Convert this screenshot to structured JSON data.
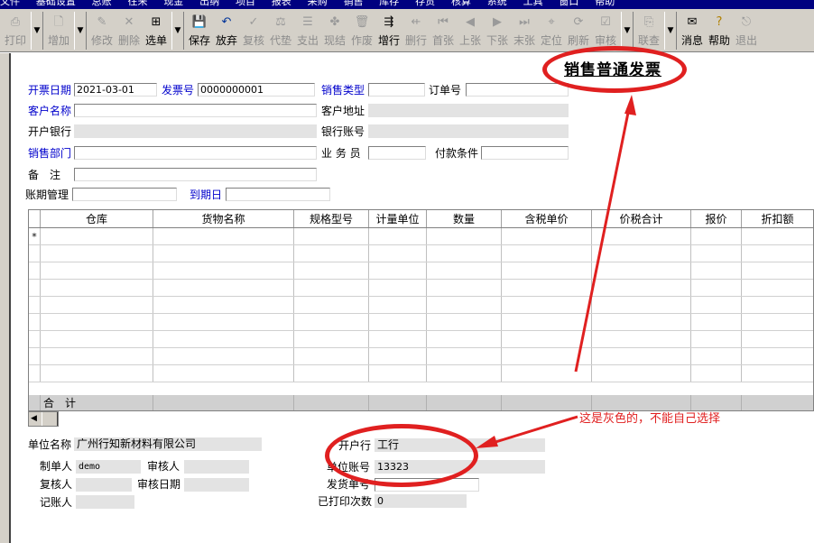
{
  "menubar": {
    "items": [
      "文件",
      "基础设置",
      "总账",
      "往来",
      "现金",
      "出纳",
      "项目",
      "报表",
      "采购",
      "销售",
      "库存",
      "存货",
      "核算",
      "系统",
      "工具",
      "窗口",
      "帮助"
    ]
  },
  "toolbar": {
    "buttons": [
      {
        "label": "打印",
        "icon": "printer-icon"
      },
      {
        "label": "增加",
        "icon": "new-document-icon"
      },
      {
        "label": "修改",
        "icon": "edit-icon"
      },
      {
        "label": "删除",
        "icon": "delete-icon"
      },
      {
        "label": "选单",
        "icon": "select-order-icon"
      },
      {
        "label": "保存",
        "icon": "save-icon"
      },
      {
        "label": "放弃",
        "icon": "undo-icon"
      },
      {
        "label": "复核",
        "icon": "review-icon"
      },
      {
        "label": "代垫",
        "icon": "advance-icon"
      },
      {
        "label": "支出",
        "icon": "expense-icon"
      },
      {
        "label": "现结",
        "icon": "cash-settle-icon"
      },
      {
        "label": "作废",
        "icon": "void-icon"
      },
      {
        "label": "增行",
        "icon": "add-row-icon"
      },
      {
        "label": "删行",
        "icon": "delete-row-icon"
      },
      {
        "label": "首张",
        "icon": "first-icon"
      },
      {
        "label": "上张",
        "icon": "prev-icon"
      },
      {
        "label": "下张",
        "icon": "next-icon"
      },
      {
        "label": "末张",
        "icon": "last-icon"
      },
      {
        "label": "定位",
        "icon": "locate-icon"
      },
      {
        "label": "刷新",
        "icon": "refresh-icon"
      },
      {
        "label": "审核",
        "icon": "audit-icon"
      },
      {
        "label": "联查",
        "icon": "link-query-icon"
      },
      {
        "label": "消息",
        "icon": "message-icon"
      },
      {
        "label": "帮助",
        "icon": "help-icon"
      },
      {
        "label": "退出",
        "icon": "exit-icon"
      }
    ]
  },
  "header": {
    "title": "销售普通发票",
    "invoice_date_label": "开票日期",
    "invoice_date": "2021-03-01",
    "invoice_no_label": "发票号",
    "invoice_no": "0000000001",
    "sales_type_label": "销售类型",
    "sales_type": "",
    "order_no_label": "订单号",
    "order_no": "",
    "customer_name_label": "客户名称",
    "customer_name": "",
    "customer_address_label": "客户地址",
    "customer_address": "",
    "bank_label": "开户银行",
    "bank": "",
    "bank_account_label": "银行账号",
    "bank_account": "",
    "sales_dept_label": "销售部门",
    "sales_dept": "",
    "salesperson_label": "业 务 员",
    "salesperson": "",
    "payment_terms_label": "付款条件",
    "payment_terms": "",
    "remark_label": "备　注",
    "remark": "",
    "account_mgmt_label": "账期管理",
    "account_mgmt": "",
    "due_date_label": "到期日",
    "due_date": ""
  },
  "grid": {
    "columns": [
      "仓库",
      "货物名称",
      "规格型号",
      "计量单位",
      "数量",
      "含税单价",
      "价税合计",
      "报价",
      "折扣额"
    ],
    "new_row_marker": "*",
    "sum_label": "合　计"
  },
  "footer": {
    "company_label": "单位名称",
    "company": "广州行知新材料有限公司",
    "bank_label": "开户行",
    "bank": "工行",
    "account_label": "单位账号",
    "account": "13323",
    "maker_label": "制单人",
    "maker": "demo",
    "reviewer_label": "审核人",
    "reviewer": "",
    "checker_label": "复核人",
    "checker": "",
    "review_date_label": "审核日期",
    "review_date": "",
    "bookkeeper_label": "记账人",
    "bookkeeper": "",
    "ship_no_label": "发货单号",
    "ship_no": "",
    "print_count_label": "已打印次数",
    "print_count": "0"
  },
  "annotation": {
    "note": "这是灰色的，不能自己选择",
    "color": "#e02020"
  }
}
